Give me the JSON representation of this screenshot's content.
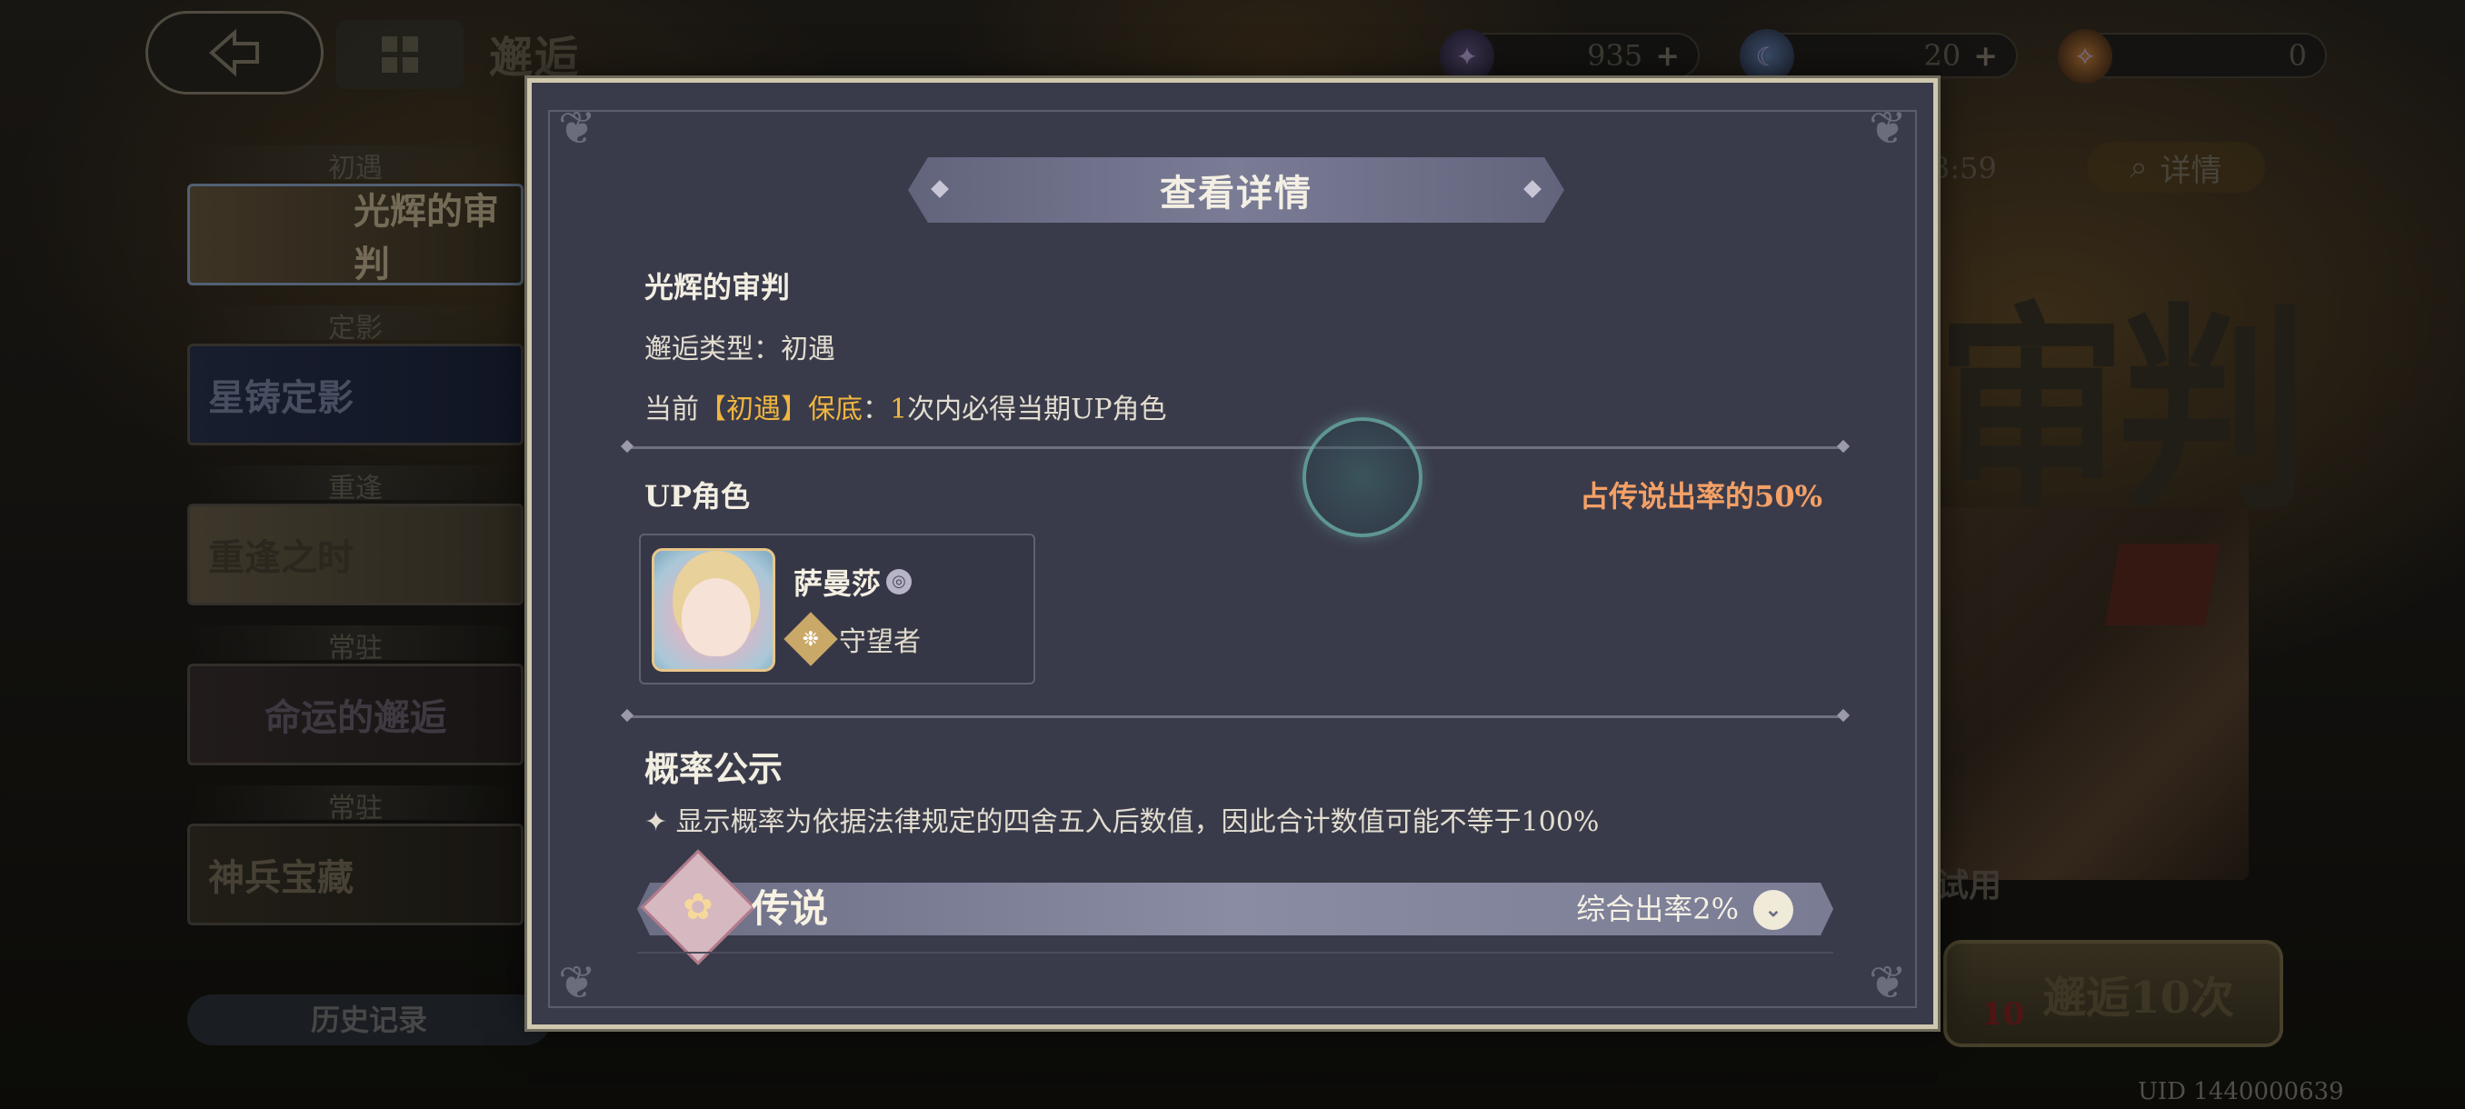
{
  "background": {
    "page_title": "邂逅",
    "currencies": [
      {
        "icon": "star-crystal-icon",
        "value": "935"
      },
      {
        "icon": "moon-orb-icon",
        "value": "20"
      },
      {
        "icon": "flame-token-icon",
        "value": "0"
      }
    ],
    "side_tabs": [
      {
        "tag": "初遇",
        "title": "光辉的审判"
      },
      {
        "tag": "定影",
        "title": "星铸定影"
      },
      {
        "tag": "重逢",
        "title": "重逢之时"
      },
      {
        "tag": "常驻",
        "title": "命运的邂逅"
      },
      {
        "tag": "常驻",
        "title": "神兵宝藏"
      }
    ],
    "history_label": "历史记录",
    "timer_text": "3:59",
    "detail_label": "详情",
    "banner_title_fragment": "审判",
    "trial_label": "试用",
    "pull_button_label": "邂逅10次",
    "pull_cost": "10",
    "uid": "UID 1440000639"
  },
  "modal": {
    "title": "查看详情",
    "banner_name": "光辉的审判",
    "banner_type": "邂逅类型：初遇",
    "pity": {
      "prefix": "当前",
      "highlight": "【初遇】保底",
      "colon": "：",
      "count": "1",
      "suffix": "次内必得当期UP角色"
    },
    "up_section_label": "UP角色",
    "up_rate_text": "占传说出率的50%",
    "character": {
      "name": "萨曼莎",
      "badge_icon": "element-badge-icon",
      "role_icon": "guardian-class-icon",
      "role": "守望者"
    },
    "prob_title": "概率公示",
    "prob_note": "✦ 显示概率为依据法律规定的四舍五入后数值，因此合计数值可能不等于100%",
    "rarity": {
      "label": "传说",
      "rate_text": "综合出率2%",
      "icon": "legendary-flower-icon"
    }
  },
  "colors": {
    "gold_highlight": "#f0b640",
    "up_rate_orange": "#f4a066",
    "modal_bg": "#3a3b4a",
    "modal_border": "#cfc8ae"
  }
}
